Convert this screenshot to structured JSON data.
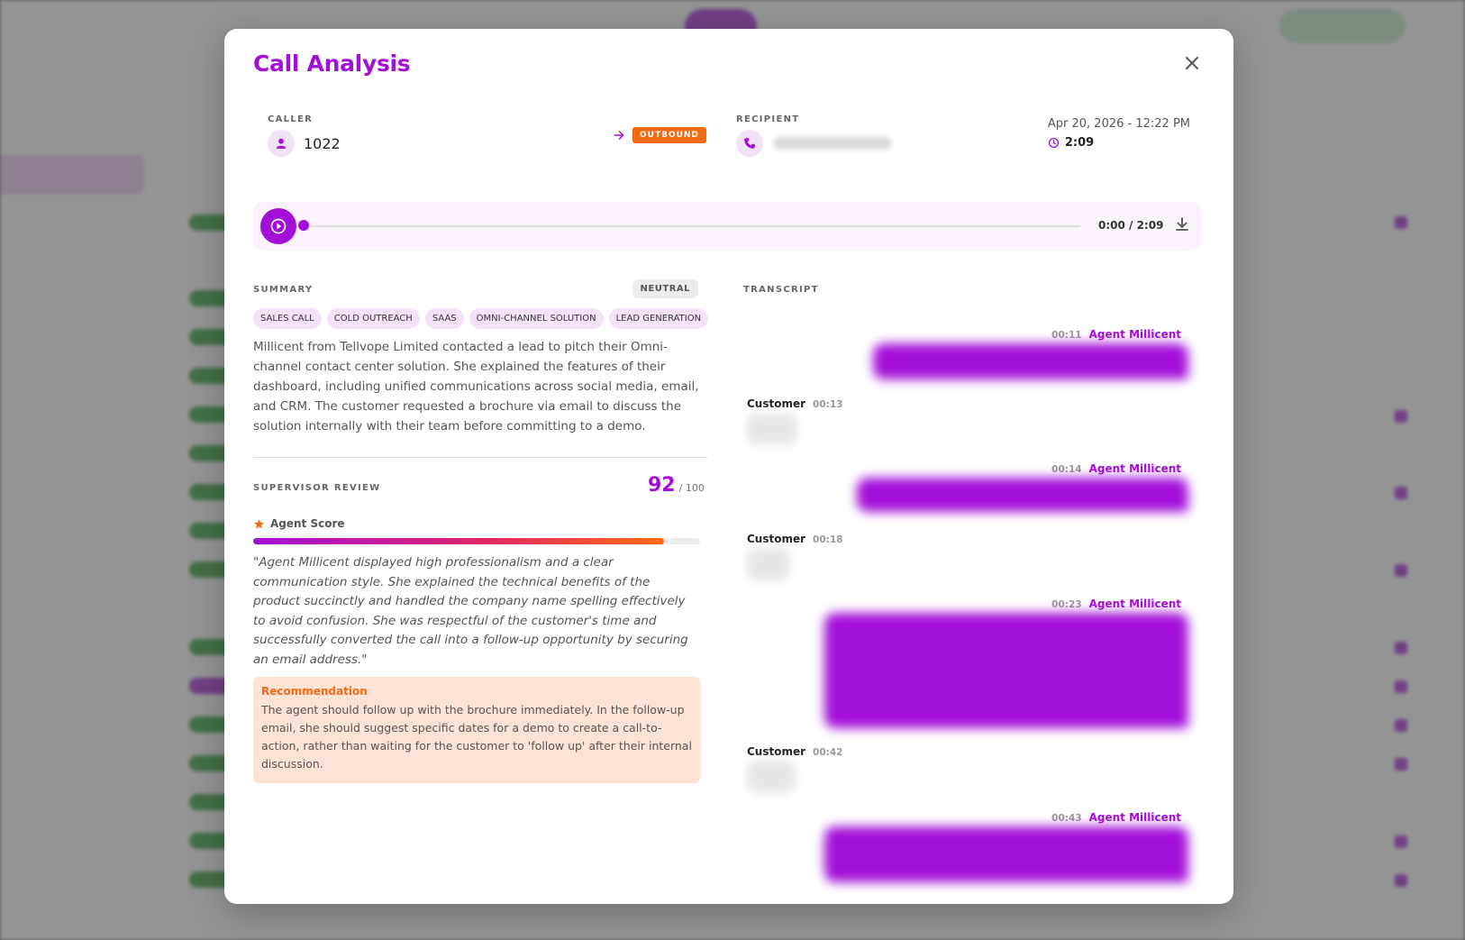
{
  "modal": {
    "title": "Call Analysis",
    "caller_label": "CALLER",
    "caller_value": "1022",
    "direction_badge": "OUTBOUND",
    "recipient_label": "RECIPIENT",
    "date": "Apr 20, 2026 - 12:22 PM",
    "duration": "2:09",
    "icons": {
      "close": "close-icon",
      "caller": "user-icon",
      "direction": "arrow-right-icon",
      "recipient": "phone-icon",
      "duration": "clock-icon",
      "play": "play-icon",
      "download": "download-icon",
      "star": "star-icon"
    }
  },
  "player": {
    "time": "0:00 / 2:09",
    "progress": 0
  },
  "summary": {
    "label": "SUMMARY",
    "sentiment": "NEUTRAL",
    "tags": [
      "SALES CALL",
      "COLD OUTREACH",
      "SAAS",
      "OMNI-CHANNEL SOLUTION",
      "LEAD GENERATION"
    ],
    "text": "Millicent from Tellvope Limited contacted a lead to pitch their Omni-channel contact center solution. She explained the features of their dashboard, including unified communications across social media, email, and CRM. The customer requested a brochure via email to discuss the solution internally with their team before committing to a demo."
  },
  "review": {
    "label": "SUPERVISOR REVIEW",
    "score": "92",
    "score_of": "/ 100",
    "score_fraction": 0.92,
    "agent_score_label": "Agent Score",
    "quote": "\"Agent Millicent displayed high professionalism and a clear communication style. She explained the technical benefits of the product succinctly and handled the company name spelling effectively to avoid confusion. She was respectful of the customer's time and successfully converted the call into a follow-up opportunity by securing an email address.\"",
    "recommendation_title": "Recommendation",
    "recommendation_text": "The agent should follow up with the brochure immediately. In the follow-up email, she should suggest specific dates for a demo to create a call-to-action, rather than waiting for the customer to 'follow up' after their internal discussion."
  },
  "transcript": {
    "label": "TRANSCRIPT",
    "messages": [
      {
        "speaker": "Agent Millicent",
        "time": "00:11"
      },
      {
        "speaker": "Customer",
        "time": "00:13"
      },
      {
        "speaker": "Agent Millicent",
        "time": "00:14"
      },
      {
        "speaker": "Customer",
        "time": "00:18"
      },
      {
        "speaker": "Agent Millicent",
        "time": "00:23"
      },
      {
        "speaker": "Customer",
        "time": "00:42"
      },
      {
        "speaker": "Agent Millicent",
        "time": "00:43"
      }
    ]
  },
  "colors": {
    "accent": "#a30fd8",
    "orange": "#f26a12",
    "reco_bg": "#fde3d6"
  }
}
